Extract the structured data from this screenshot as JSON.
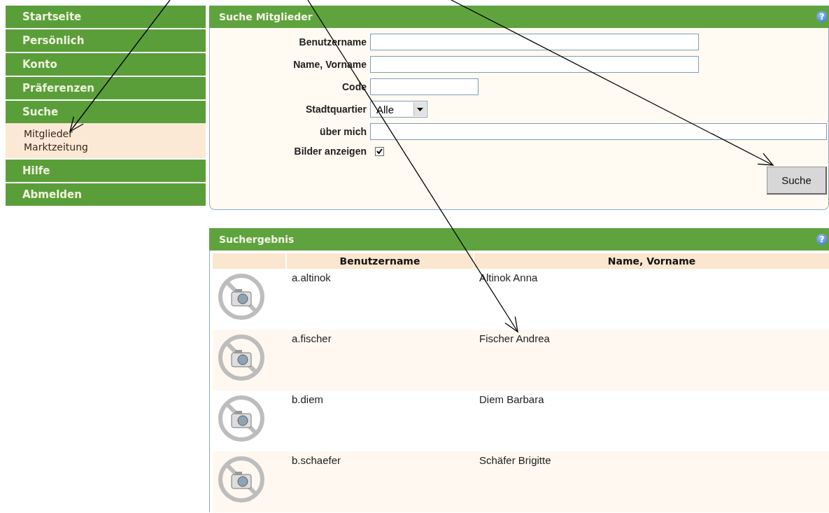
{
  "sidebar": {
    "items": [
      {
        "label": "Startseite"
      },
      {
        "label": "Persönlich"
      },
      {
        "label": "Konto"
      },
      {
        "label": "Präferenzen"
      },
      {
        "label": "Suche",
        "children": [
          {
            "label": "Mitglieder"
          },
          {
            "label": "Marktzeitung"
          }
        ]
      },
      {
        "label": "Hilfe"
      },
      {
        "label": "Abmelden"
      }
    ]
  },
  "search_panel": {
    "title": "Suche Mitglieder",
    "help": "?",
    "fields": [
      {
        "kind": "text",
        "label": "Benutzername"
      },
      {
        "kind": "text",
        "label": "Name, Vorname"
      },
      {
        "kind": "text",
        "label": "Code"
      },
      {
        "kind": "select",
        "label": "Stadtquartier",
        "value": "Alle"
      },
      {
        "kind": "text",
        "label": "über mich"
      },
      {
        "kind": "checkbox",
        "label": "Bilder anzeigen",
        "checked": true
      }
    ],
    "button": "Suche"
  },
  "results_panel": {
    "title": "Suchergebnis",
    "help": "?",
    "columns": [
      "Benutzername",
      "Name, Vorname"
    ],
    "rows": [
      {
        "username": "a.altinok",
        "name": "Altinok Anna"
      },
      {
        "username": "a.fischer",
        "name": "Fischer Andrea"
      },
      {
        "username": "b.diem",
        "name": "Diem Barbara"
      },
      {
        "username": "b.schaefer",
        "name": "Schäfer Brigitte"
      }
    ]
  }
}
